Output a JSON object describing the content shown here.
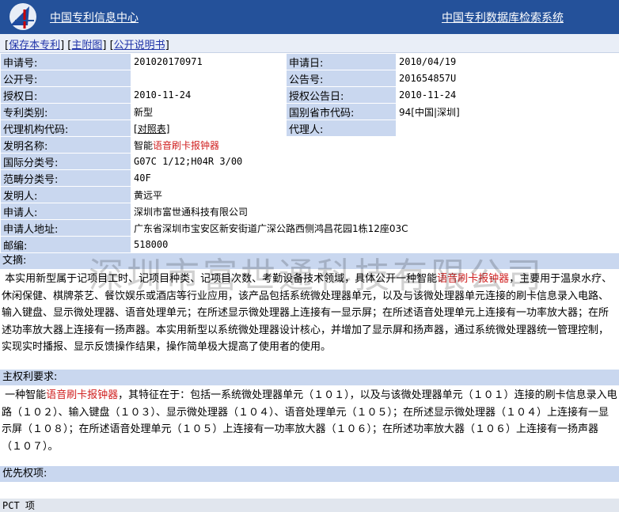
{
  "header": {
    "site_title": "中国专利信息中心",
    "db_title": "中国专利数据库检索系统"
  },
  "linkbar": {
    "save": "保存本专利",
    "main_figure": "主附图",
    "publication": "公开说明书"
  },
  "fields": {
    "application_no": {
      "label": "申请号:",
      "value": "201020170971"
    },
    "application_date": {
      "label": "申请日:",
      "value": "2010/04/19"
    },
    "publication_no": {
      "label": "公开号:",
      "value": ""
    },
    "announcement_no": {
      "label": "公告号:",
      "value": "201654857U"
    },
    "grant_date": {
      "label": "授权日:",
      "value": "2010-11-24"
    },
    "grant_announce_date": {
      "label": "授权公告日:",
      "value": "2010-11-24"
    },
    "patent_type": {
      "label": "专利类别:",
      "value": "新型"
    },
    "country_code": {
      "label": "国别省市代码:",
      "value": "94[中国|深圳]"
    },
    "agency_code": {
      "label": "代理机构代码:",
      "value_link": "对照表"
    },
    "agent": {
      "label": "代理人:",
      "value": ""
    },
    "invention_name": {
      "label": "发明名称:",
      "prefix": "智能",
      "highlight": "语音刷卡报钟器"
    },
    "ipc": {
      "label": "国际分类号:",
      "value": "G07C 1/12;H04R 3/00"
    },
    "locarno": {
      "label": "范畴分类号:",
      "value": "40F"
    },
    "inventor": {
      "label": "发明人:",
      "value": "黄远平"
    },
    "applicant": {
      "label": "申请人:",
      "value": "深圳市富世通科技有限公司"
    },
    "applicant_address": {
      "label": "申请人地址:",
      "value": "广东省深圳市宝安区新安街道广深公路西侧鸿昌花园1栋12座03C"
    },
    "postcode": {
      "label": "邮编:",
      "value": "518000"
    }
  },
  "abstract": {
    "label": "文摘:",
    "part1": "本实用新型属于记项目工时、记项目种类、记项目次数、考勤设备技术领域，具体公开一种智能",
    "highlight": "语音刷卡报钟器",
    "part2": "，主要用于温泉水疗、休闲保健、棋牌茶艺、餐饮娱乐或酒店等行业应用，该产品包括系统微处理器单元，以及与该微处理器单元连接的刷卡信息录入电路、输入键盘、显示微处理器、语音处理单元；在所述显示微处理器上连接有一显示屏；在所述语音处理单元上连接有一功率放大器；在所述功率放大器上连接有一扬声器。本实用新型以系统微处理器设计核心，并增加了显示屏和扬声器，通过系统微处理器统一管理控制，实现实时播报、显示反馈操作结果，操作简单极大提高了使用者的使用。"
  },
  "claims": {
    "label": "主权利要求:",
    "part1": "一种智能",
    "highlight": "语音刷卡报钟器",
    "part2": "，其特征在于：包括一系统微处理器单元（１０１），以及与该微处理器单元（１０１）连接的刷卡信息录入电路（１０２）、输入键盘（１０３）、显示微处理器（１０４）、语音处理单元（１０５）；在所述显示微处理器（１０４）上连接有一显示屏（１０８）；在所述语音处理单元（１０５）上连接有一功率放大器（１０６）；在所述功率放大器（１０６）上连接有一扬声器（１０７）。"
  },
  "priority": {
    "label": "优先权项:"
  },
  "watermark": "深圳市富世通科技有限公司",
  "bottom": {
    "label": "PCT 项"
  },
  "colors": {
    "header": "#24519a",
    "label_bg": "#c9d7ef",
    "highlight": "#d02020",
    "link": "#1f33a8"
  }
}
